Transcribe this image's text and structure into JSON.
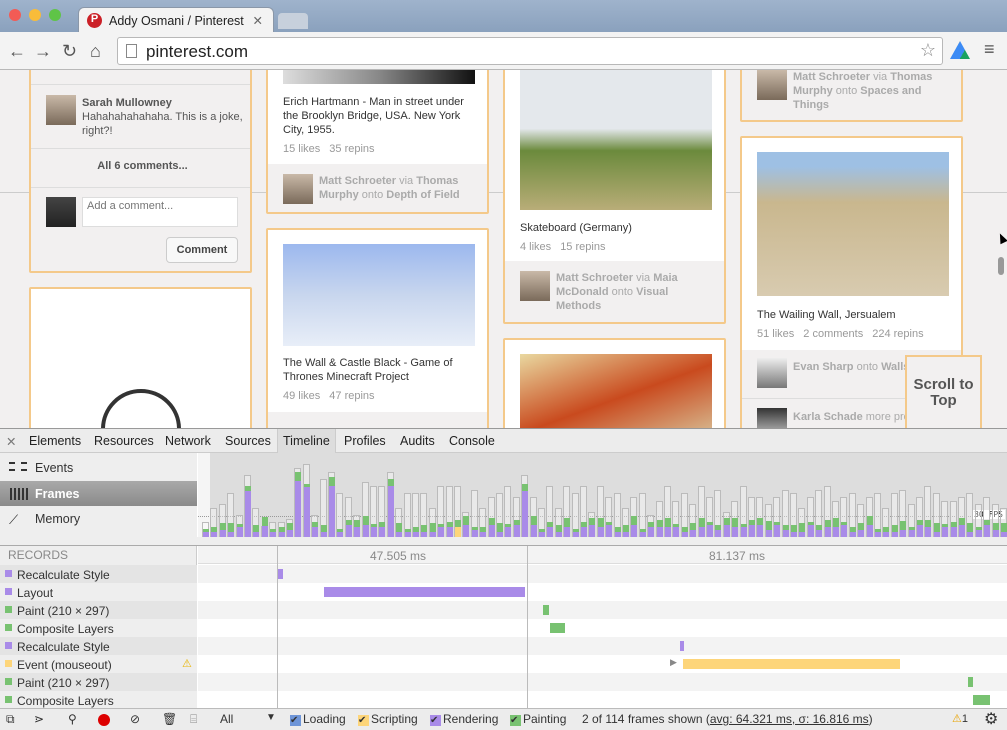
{
  "browser": {
    "tab_title": "Addy Osmani / Pinterest",
    "url": "pinterest.com"
  },
  "page": {
    "comment": {
      "author": "Sarah Mullowney",
      "text": "Hahahahahahaha. This is a joke, right?!",
      "all_comments": "All 6 comments...",
      "placeholder": "Add a comment...",
      "button": "Comment"
    },
    "pins": [
      {
        "title": "Erich Hartmann - Man in street under the Brooklyn Bridge, USA. New York City, 1955.",
        "likes": "15 likes",
        "repins": "35 repins",
        "pinner": "Matt Schroeter",
        "via": "via",
        "from": "Thomas Murphy",
        "onto": "onto",
        "board": "Depth of Field"
      },
      {
        "title": "The Wall & Castle Black - Game of Thrones Minecraft Project",
        "likes": "49 likes",
        "repins": "47 repins"
      },
      {
        "title": "Skateboard (Germany)",
        "likes": "4 likes",
        "repins": "15 repins",
        "pinner": "Matt Schroeter",
        "via": "via",
        "from": "Maia McDonald",
        "onto": "onto",
        "board": "Visual Methods"
      },
      {
        "pinner": "Matt Schroeter",
        "via": "via",
        "from": "Thomas Murphy",
        "onto": "onto",
        "board": "Spaces and Things"
      },
      {
        "title": "The Wailing Wall, Jersualem",
        "likes": "51 likes",
        "comments": "2 comments",
        "repins": "224 repins",
        "pinner": "Evan Sharp",
        "onto": "onto",
        "board": "Walls",
        "pinner2": "Karla Schade",
        "more": "more pro"
      }
    ],
    "scroll_to_top": "Scroll to Top"
  },
  "devtools": {
    "tabs": [
      "Elements",
      "Resources",
      "Network",
      "Sources",
      "Timeline",
      "Profiles",
      "Audits",
      "Console"
    ],
    "active_tab": "Timeline",
    "modes": [
      "Events",
      "Frames",
      "Memory"
    ],
    "active_mode": "Frames",
    "fps_label": "30 FPS",
    "frame_durations_ms": [
      20,
      40,
      45,
      60,
      30,
      85,
      40,
      15,
      20,
      20,
      25,
      95,
      100,
      30,
      80,
      90,
      60,
      55,
      30,
      75,
      70,
      70,
      90,
      40,
      60,
      60,
      60,
      40,
      70,
      70,
      70,
      35,
      65,
      40,
      55,
      60,
      70,
      55,
      85,
      55,
      40,
      70,
      40,
      70,
      60,
      70,
      35,
      70,
      55,
      60,
      40,
      55,
      60,
      30,
      50,
      70,
      50,
      60,
      45,
      70,
      55,
      65,
      35,
      50,
      70,
      55,
      55,
      45,
      55,
      65,
      60,
      40,
      55,
      65,
      70,
      50,
      55,
      60,
      45,
      55,
      60,
      40,
      60,
      65,
      45,
      55,
      70,
      60,
      50,
      50,
      55,
      60,
      45,
      55,
      45,
      40
    ],
    "records_header": "RECORDS",
    "ruler": [
      "47.505 ms",
      "81.137 ms"
    ],
    "records": [
      {
        "label": "Recalculate Style",
        "category": "rendering"
      },
      {
        "label": "Layout",
        "category": "rendering"
      },
      {
        "label": "Paint (210 × 297)",
        "category": "painting"
      },
      {
        "label": "Composite Layers",
        "category": "painting"
      },
      {
        "label": "Recalculate Style",
        "category": "rendering"
      },
      {
        "label": "Event (mouseout)",
        "category": "scripting",
        "warning": true
      },
      {
        "label": "Paint (210 × 297)",
        "category": "painting"
      },
      {
        "label": "Composite Layers",
        "category": "painting"
      }
    ],
    "colors": {
      "rendering": "#a98be8",
      "painting": "#78c271",
      "scripting": "#fdd57a",
      "loading": "#6e95d8"
    },
    "filter": "All",
    "checkboxes": [
      {
        "label": "Loading",
        "checked": true
      },
      {
        "label": "Scripting",
        "checked": true
      },
      {
        "label": "Rendering",
        "checked": true
      },
      {
        "label": "Painting",
        "checked": true
      }
    ],
    "status_prefix": "2 of 114 frames shown (",
    "status_stats": "avg: 64.321 ms, σ: 16.816 ms",
    "status_suffix": ")",
    "warnings": "1"
  }
}
